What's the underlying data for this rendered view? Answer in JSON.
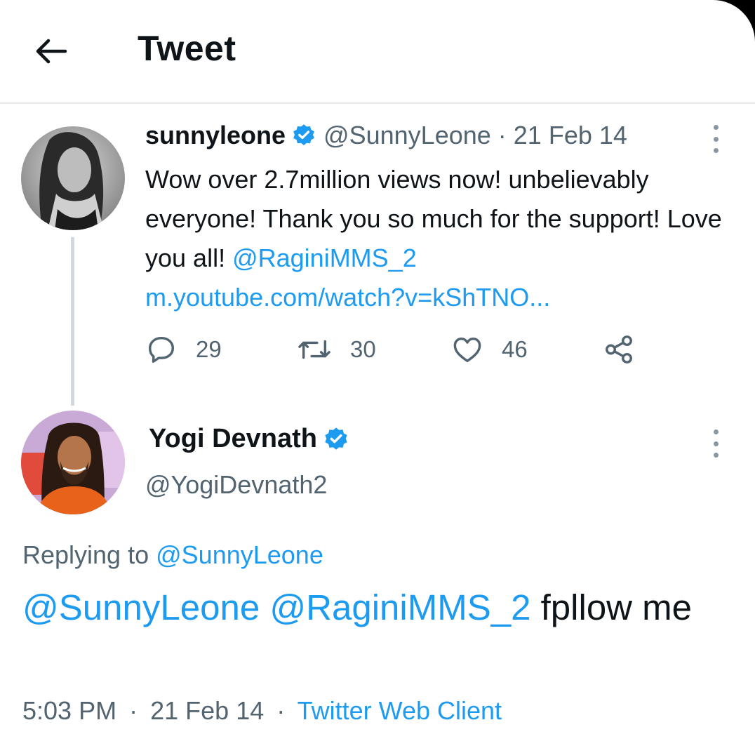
{
  "header": {
    "title": "Tweet"
  },
  "parent_tweet": {
    "display_name": "sunnyleone",
    "handle": "@SunnyLeone",
    "separator": "·",
    "date": "21 Feb 14",
    "text": "Wow over 2.7million views now! unbelievably everyone! Thank you so much for the support! Love you all!",
    "mention": "@RaginiMMS_2",
    "link": "m.youtube.com/watch?v=kShTNO...",
    "replies": "29",
    "retweets": "30",
    "likes": "46"
  },
  "reply_tweet": {
    "display_name": "Yogi Devnath",
    "handle": "@YogiDevnath2",
    "replying_label": "Replying to",
    "replying_handle": "@SunnyLeone",
    "mention_1": "@SunnyLeone",
    "mention_2": "@RaginiMMS_2",
    "text": "fpllow me",
    "time": "5:03 PM",
    "separator": "·",
    "date": "21 Feb 14",
    "client": "Twitter Web Client"
  },
  "colors": {
    "link": "#1d9bf0",
    "secondary_text": "#536471",
    "verified": "#1d9bf0"
  }
}
